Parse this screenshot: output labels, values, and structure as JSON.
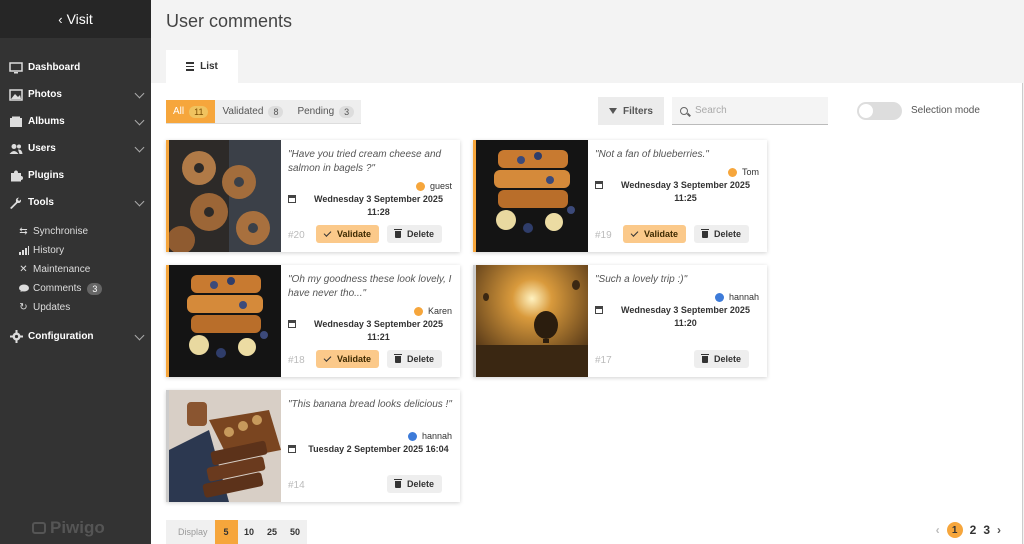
{
  "sidebar": {
    "visit": "Visit",
    "brand": "Piwigo",
    "items": [
      {
        "label": "Dashboard"
      },
      {
        "label": "Photos"
      },
      {
        "label": "Albums"
      },
      {
        "label": "Users"
      },
      {
        "label": "Plugins"
      },
      {
        "label": "Tools"
      },
      {
        "label": "Configuration"
      }
    ],
    "tools_sub": [
      {
        "label": "Synchronise"
      },
      {
        "label": "History"
      },
      {
        "label": "Maintenance"
      },
      {
        "label": "Comments",
        "badge": "3"
      },
      {
        "label": "Updates"
      }
    ]
  },
  "header": {
    "title": "User comments",
    "tab": "List"
  },
  "filters": {
    "all": {
      "label": "All",
      "count": "11"
    },
    "validated": {
      "label": "Validated",
      "count": "8"
    },
    "pending": {
      "label": "Pending",
      "count": "3"
    },
    "filters_label": "Filters",
    "search_placeholder": "Search",
    "selection_mode": "Selection mode"
  },
  "comments": [
    {
      "quote": "\"Have you tried cream cheese and salmon in bagels ?\"",
      "author": "guest",
      "date": "Wednesday 3 September 2025 11:28",
      "id": "#20",
      "validate": "Validate",
      "delete": "Delete"
    },
    {
      "quote": "\"Not a fan of blueberries.\"",
      "author": "Tom",
      "date": "Wednesday 3 September 2025 11:25",
      "id": "#19",
      "validate": "Validate",
      "delete": "Delete"
    },
    {
      "quote": "\"Oh my goodness these look lovely, I have never tho...\"",
      "author": "Karen",
      "date": "Wednesday 3 September 2025 11:21",
      "id": "#18",
      "validate": "Validate",
      "delete": "Delete"
    },
    {
      "quote": "\"Such a lovely trip :)\"",
      "author": "hannah",
      "date": "Wednesday 3 September 2025 11:20",
      "id": "#17",
      "delete": "Delete"
    },
    {
      "quote": "\"This banana bread looks delicious !\"",
      "author": "hannah",
      "date": "Tuesday 2 September 2025 16:04",
      "id": "#14",
      "delete": "Delete"
    }
  ],
  "footer": {
    "display_label": "Display",
    "options": [
      "5",
      "10",
      "25",
      "50"
    ],
    "selected": "5",
    "pages": [
      "1",
      "2",
      "3"
    ],
    "current_page": "1"
  },
  "colors": {
    "accent": "#f6a63c",
    "sidebar_bg": "#333333",
    "validate_bg": "#fbc98a",
    "guest_icon": "#f6a63c",
    "admin_icon": "#3d7bd9"
  }
}
